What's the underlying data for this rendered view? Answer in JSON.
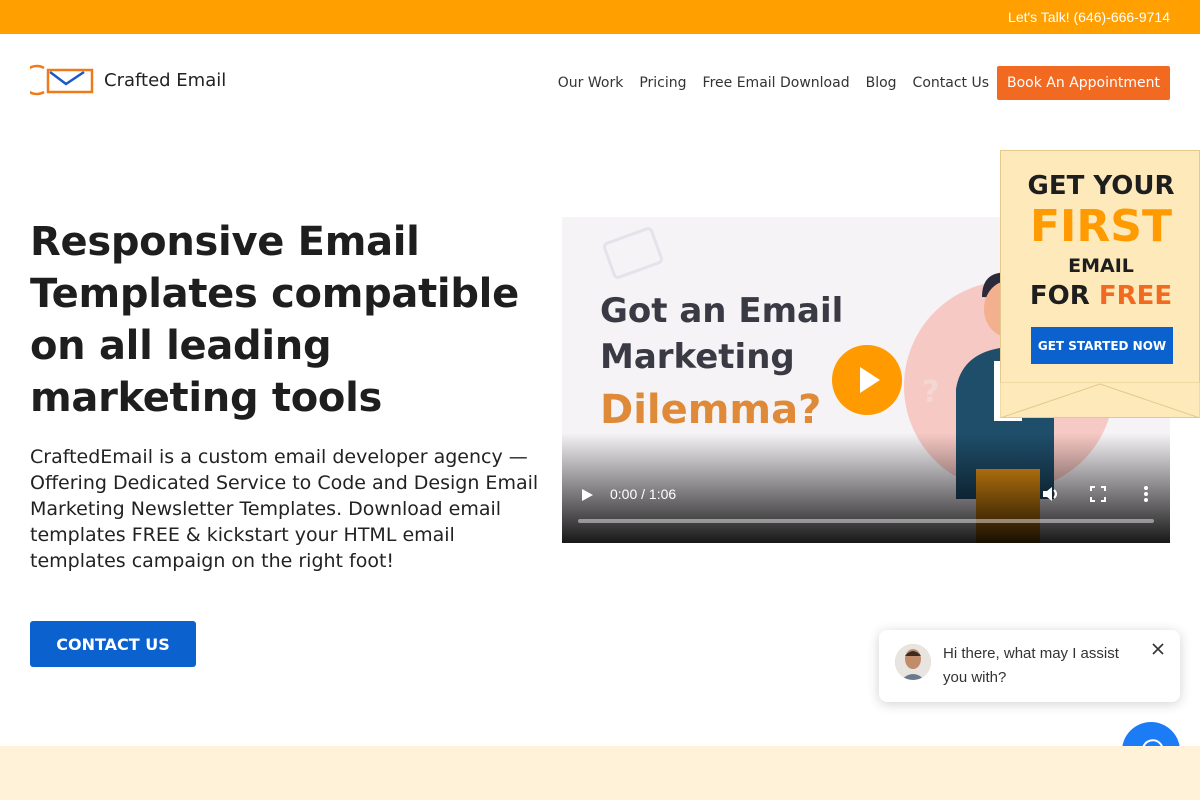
{
  "topbar": {
    "phone": "Let's Talk! (646)-666-9714"
  },
  "header": {
    "brand": "Crafted Email",
    "nav": [
      "Our Work",
      "Pricing",
      "Free Email Download",
      "Blog",
      "Contact Us"
    ],
    "cta": "Book An Appointment"
  },
  "hero": {
    "title": "Responsive Email Templates compatible on all leading marketing tools",
    "description": "CraftedEmail is a custom email developer agency — Offering Dedicated Service to Code and Design Email Marketing Newsletter Templates. Download email templates FREE & kickstart your HTML email templates campaign on the right foot!",
    "button": "CONTACT US"
  },
  "video": {
    "line1": "Got an Email",
    "line2": "Marketing",
    "line3": "Dilemma?",
    "time": "0:00 / 1:06"
  },
  "promo": {
    "line1": "GET YOUR",
    "line2": "FIRST",
    "line3": "EMAIL",
    "line4_a": "FOR",
    "line4_b": "FREE",
    "button": "GET STARTED NOW"
  },
  "chat": {
    "message": "Hi there, what may I assist you with?"
  },
  "colors": {
    "accent_orange": "#ffa000",
    "cta_orange": "#f26a21",
    "primary_blue": "#0b62cf",
    "chat_blue": "#1b7cf5"
  },
  "icons": [
    "logo-mark-icon",
    "play-icon",
    "volume-icon",
    "fullscreen-icon",
    "more-vertical-icon",
    "close-icon",
    "chat-icon"
  ]
}
